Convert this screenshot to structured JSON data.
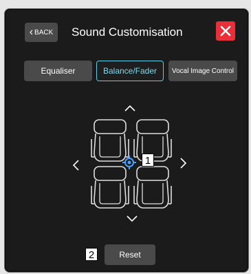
{
  "header": {
    "back_label": "BACK",
    "title": "Sound Customisation"
  },
  "tabs": [
    {
      "label": "Equaliser",
      "active": false
    },
    {
      "label": "Balance/Fader",
      "active": true
    },
    {
      "label": "Vocal Image Control",
      "active": false
    }
  ],
  "markers": {
    "focus_point": "1",
    "reset": "2"
  },
  "reset_label": "Reset",
  "colors": {
    "panel_bg": "#1b1b1b",
    "button_bg": "#4a4a4a",
    "active_tab_border": "#5ad0ea",
    "close_red": "#e8303a",
    "focus_point": "#4aa3ff"
  },
  "icons": {
    "back": "chevron-left-icon",
    "close": "close-icon",
    "up": "chevron-up-icon",
    "down": "chevron-down-icon",
    "left": "chevron-left-icon",
    "right": "chevron-right-icon",
    "seat": "car-seat-icon",
    "focus": "target-crosshair-icon"
  }
}
